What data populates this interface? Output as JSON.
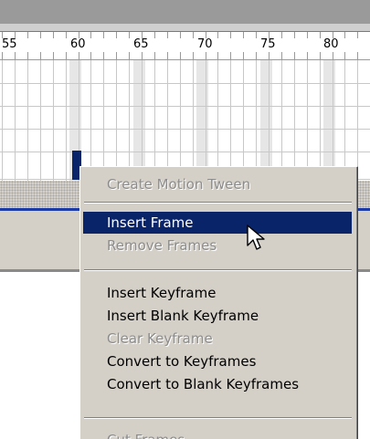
{
  "ruler": {
    "labels": [
      "55",
      "60",
      "65",
      "70",
      "75",
      "80"
    ]
  },
  "timeline": {
    "selected_frame": 60
  },
  "context_menu": {
    "items": [
      {
        "label": "Create Motion Tween",
        "enabled": false
      },
      {
        "label": "Insert Frame",
        "enabled": true,
        "highlighted": true
      },
      {
        "label": "Remove Frames",
        "enabled": false
      },
      {
        "label": "Insert Keyframe",
        "enabled": true
      },
      {
        "label": "Insert Blank Keyframe",
        "enabled": true
      },
      {
        "label": "Clear Keyframe",
        "enabled": false
      },
      {
        "label": "Convert to Keyframes",
        "enabled": true
      },
      {
        "label": "Convert to Blank Keyframes",
        "enabled": true
      },
      {
        "label": "Cut Frames",
        "enabled": false
      }
    ]
  },
  "colors": {
    "selection": "#0a246a",
    "menu_background": "#d4d0c8",
    "disabled_text": "#8c8c8c"
  },
  "cursor": {
    "icon": "arrow-pointer-icon"
  }
}
